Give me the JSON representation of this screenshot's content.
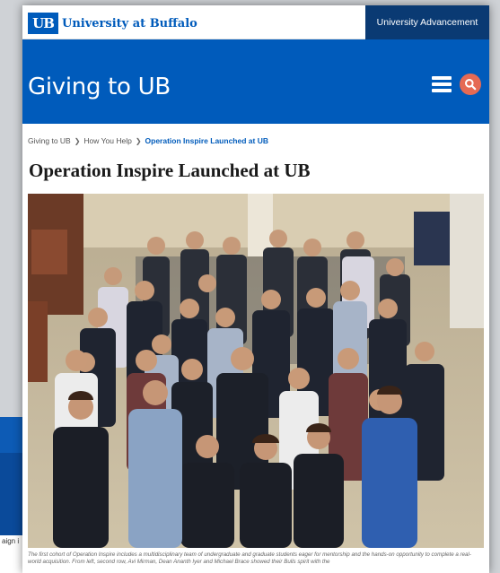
{
  "background_window": {
    "text": "aign i"
  },
  "header": {
    "logo_mark": "UB",
    "logo_text": "University at Buffalo",
    "advancement_link": "University Advancement"
  },
  "hero": {
    "title": "Giving to UB"
  },
  "breadcrumb": {
    "items": [
      "Giving to UB",
      "How You Help"
    ],
    "current": "Operation Inspire Launched at UB"
  },
  "article": {
    "title": "Operation Inspire Launched at UB",
    "caption": "The first cohort of Operation Inspire includes a multidisciplinary team of undergraduate and graduate students eager for mentorship and the hands-on opportunity to complete a real-world acquisition. From left, second row, Avi Mirman, Dean Ananth Iyer and Michael Brace showed their Bulls spirit with the"
  },
  "colors": {
    "brand_blue": "#005bbb",
    "dark_navy": "#0a3a73",
    "search_accent": "#e56a54"
  }
}
